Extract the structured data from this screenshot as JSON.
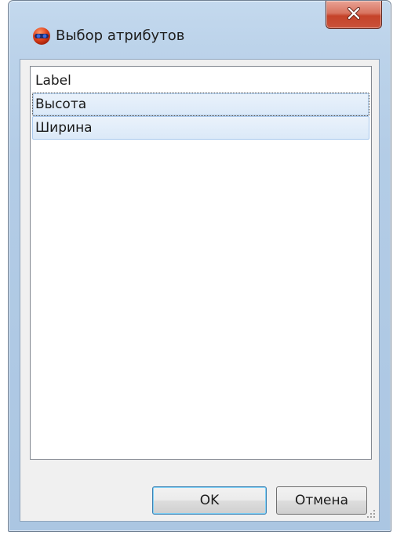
{
  "window": {
    "title": "Выбор атрибутов",
    "icon": "app-logo-icon",
    "close_label": "x"
  },
  "attribute_list": {
    "items": [
      {
        "label": "Label",
        "state": "normal"
      },
      {
        "label": "Высота",
        "state": "focused"
      },
      {
        "label": "Ширина",
        "state": "selected"
      }
    ]
  },
  "buttons": {
    "ok_label": "OK",
    "cancel_label": "Отмена"
  },
  "colors": {
    "selection": "#dbe9f8",
    "selection_border": "#a8c8ec",
    "close_button": "#c5432a",
    "default_button_border": "#3c7fb1"
  }
}
